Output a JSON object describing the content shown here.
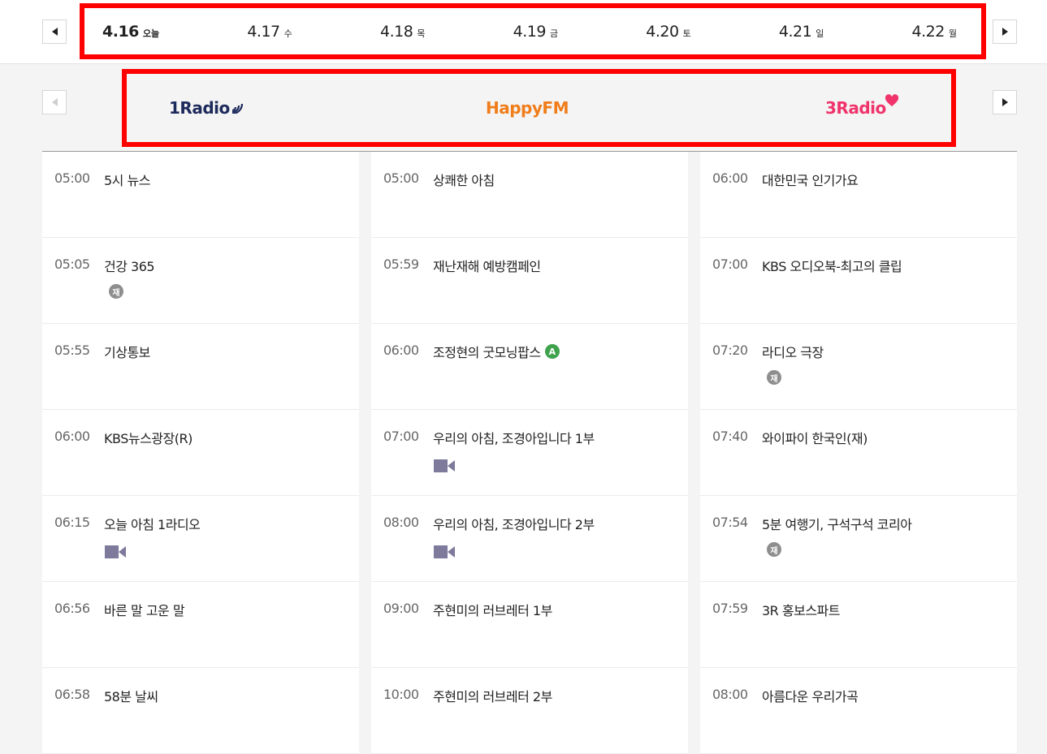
{
  "dates": [
    {
      "num": "4.16",
      "day": "오늘",
      "active": true
    },
    {
      "num": "4.17",
      "day": "수"
    },
    {
      "num": "4.18",
      "day": "목"
    },
    {
      "num": "4.19",
      "day": "금"
    },
    {
      "num": "4.20",
      "day": "토"
    },
    {
      "num": "4.21",
      "day": "일"
    },
    {
      "num": "4.22",
      "day": "월"
    }
  ],
  "channels": {
    "ch1": "1Radio",
    "ch2": "HappyFM",
    "ch3": "3Radio"
  },
  "colors": {
    "highlight": "#ff0000",
    "badge_green": "#3fa34d",
    "video_icon": "#7d7a9c"
  },
  "badges": {
    "rerun": "재",
    "a": "A"
  },
  "schedule": [
    [
      {
        "time": "05:00",
        "title": "5시 뉴스"
      },
      {
        "time": "05:05",
        "title": "건강 365",
        "rerun": true
      },
      {
        "time": "05:55",
        "title": "기상통보"
      },
      {
        "time": "06:00",
        "title": "KBS뉴스광장(R)"
      },
      {
        "time": "06:15",
        "title": "오늘 아침 1라디오",
        "video": true
      },
      {
        "time": "06:56",
        "title": "바른 말 고운 말"
      },
      {
        "time": "06:58",
        "title": "58분 날씨"
      }
    ],
    [
      {
        "time": "05:00",
        "title": "상쾌한 아침"
      },
      {
        "time": "05:59",
        "title": "재난재해 예방캠페인"
      },
      {
        "time": "06:00",
        "title": "조정현의 굿모닝팝스",
        "badge_a": true
      },
      {
        "time": "07:00",
        "title": "우리의 아침, 조경아입니다 1부",
        "video": true
      },
      {
        "time": "08:00",
        "title": "우리의 아침, 조경아입니다 2부",
        "video": true
      },
      {
        "time": "09:00",
        "title": "주현미의 러브레터 1부"
      },
      {
        "time": "10:00",
        "title": "주현미의 러브레터 2부"
      }
    ],
    [
      {
        "time": "06:00",
        "title": "대한민국 인기가요"
      },
      {
        "time": "07:00",
        "title": "KBS 오디오북-최고의 클립"
      },
      {
        "time": "07:20",
        "title": "라디오 극장",
        "rerun": true
      },
      {
        "time": "07:40",
        "title": "와이파이 한국인(재)"
      },
      {
        "time": "07:54",
        "title": "5분 여행기, 구석구석 코리아",
        "rerun": true
      },
      {
        "time": "07:59",
        "title": "3R 홍보스파트"
      },
      {
        "time": "08:00",
        "title": "아름다운 우리가곡"
      }
    ]
  ]
}
